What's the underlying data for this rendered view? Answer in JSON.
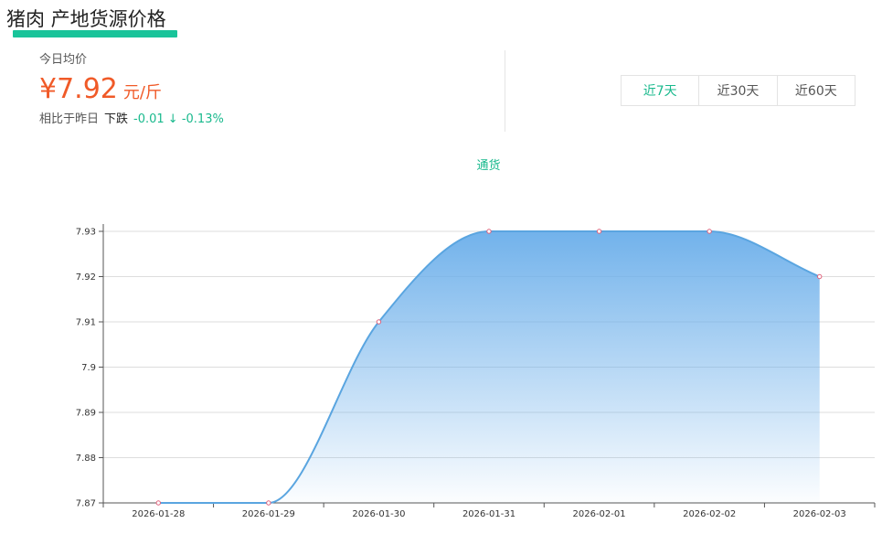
{
  "page": {
    "title": "猪肉 产地货源价格"
  },
  "summary": {
    "today_label": "今日均价",
    "price": "¥7.92",
    "unit": "元/斤",
    "compare_label": "相比于昨日",
    "trend": "下跌",
    "change": "-0.01 ↓ -0.13%"
  },
  "range_tabs": [
    {
      "label": "近7天",
      "active": true
    },
    {
      "label": "近30天",
      "active": false
    },
    {
      "label": "近60天",
      "active": false
    }
  ],
  "colors": {
    "accent": "#19b98d",
    "price": "#f05a28",
    "line": "#5aa5e0",
    "area_top": "#6aaeea",
    "point": "#e0607a"
  },
  "chart_data": {
    "type": "area",
    "legend": [
      "通货"
    ],
    "x": [
      "2026-01-28",
      "2026-01-29",
      "2026-01-30",
      "2026-01-31",
      "2026-02-01",
      "2026-02-02",
      "2026-02-03"
    ],
    "series": [
      {
        "name": "通货",
        "values": [
          7.87,
          7.87,
          7.91,
          7.93,
          7.93,
          7.93,
          7.92
        ]
      }
    ],
    "y_ticks": [
      "7.87",
      "7.88",
      "7.89",
      "7.9",
      "7.91",
      "7.92",
      "7.93"
    ],
    "ylim": [
      7.87,
      7.93
    ],
    "grid": true,
    "smooth": true
  }
}
